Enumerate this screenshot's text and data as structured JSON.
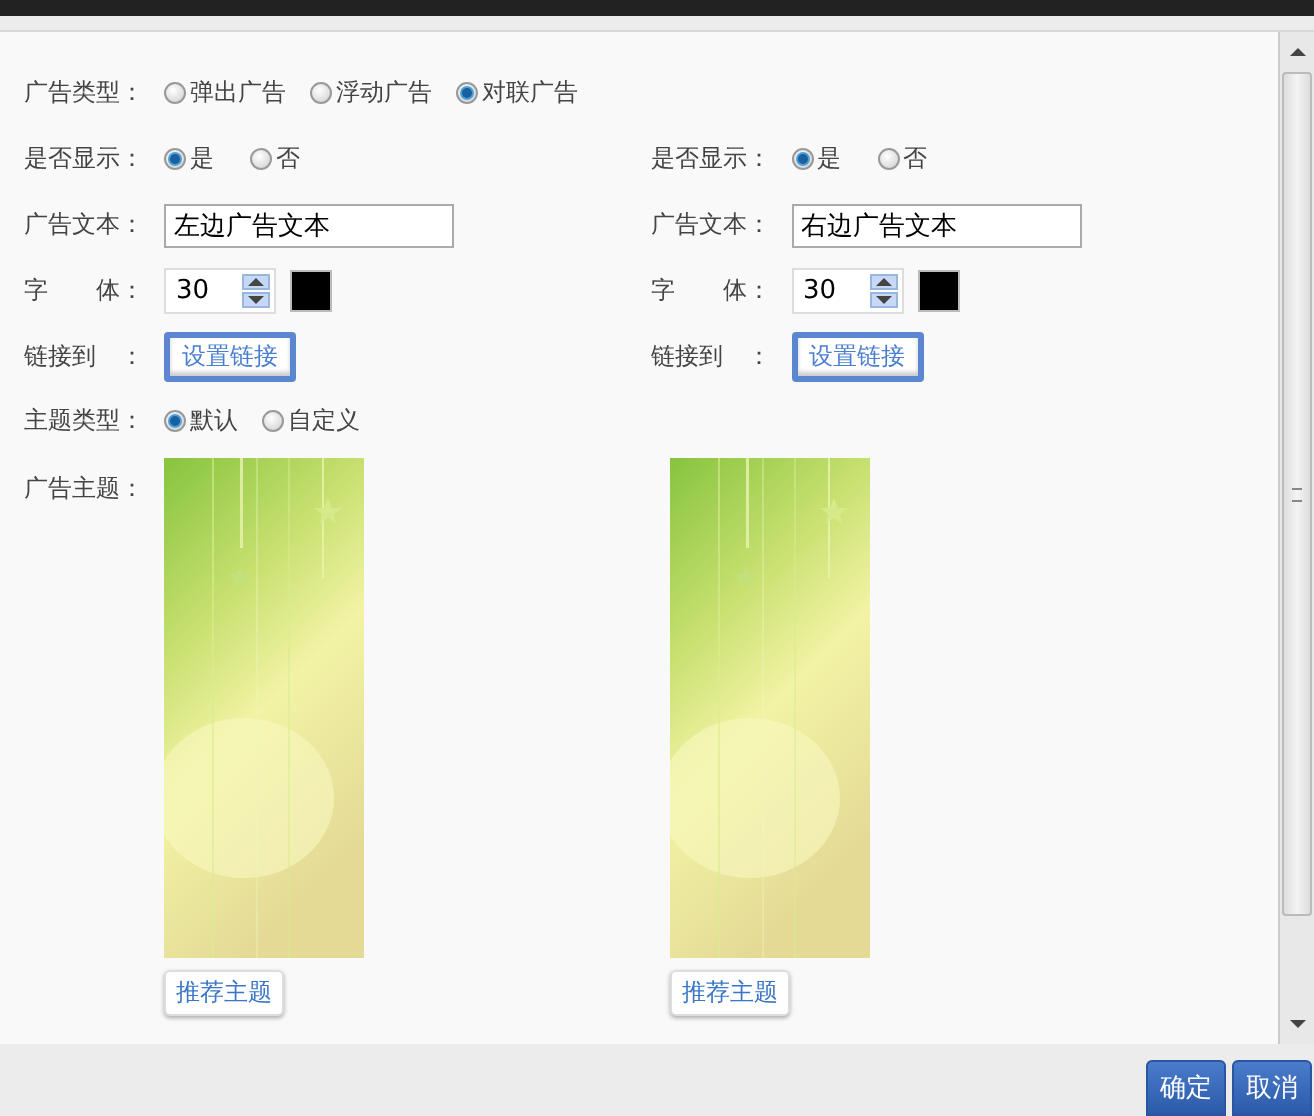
{
  "ad_type": {
    "label": "广告类型：",
    "options": [
      {
        "label": "弹出广告",
        "selected": false
      },
      {
        "label": "浮动广告",
        "selected": false
      },
      {
        "label": "对联广告",
        "selected": true
      }
    ]
  },
  "sides": [
    {
      "show": {
        "label": "是否显示：",
        "options": [
          {
            "label": "是",
            "selected": true
          },
          {
            "label": "否",
            "selected": false
          }
        ]
      },
      "text": {
        "label": "广告文本：",
        "value": "左边广告文本"
      },
      "font": {
        "label": "字　　体：",
        "size": "30",
        "color": "#000000"
      },
      "link": {
        "label": "链接到　：",
        "button": "设置链接"
      }
    },
    {
      "show": {
        "label": "是否显示：",
        "options": [
          {
            "label": "是",
            "selected": true
          },
          {
            "label": "否",
            "selected": false
          }
        ]
      },
      "text": {
        "label": "广告文本：",
        "value": "右边广告文本"
      },
      "font": {
        "label": "字　　体：",
        "size": "30",
        "color": "#000000"
      },
      "link": {
        "label": "链接到　：",
        "button": "设置链接"
      }
    }
  ],
  "theme_type": {
    "label": "主题类型：",
    "options": [
      {
        "label": "默认",
        "selected": true
      },
      {
        "label": "自定义",
        "selected": false
      }
    ]
  },
  "theme": {
    "label": "广告主题：",
    "items": [
      {
        "kind": "picture",
        "button": "推荐主题"
      },
      {
        "kind": "picture",
        "button": "推荐主题"
      }
    ]
  },
  "buttons": [
    "确定",
    "取消"
  ]
}
